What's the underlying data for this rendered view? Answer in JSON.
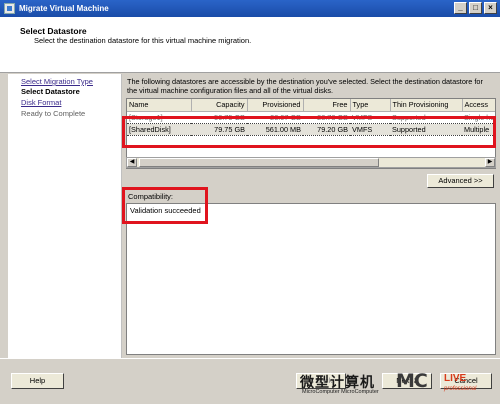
{
  "window": {
    "title": "Migrate Virtual Machine",
    "min": "_",
    "max": "□",
    "close": "×"
  },
  "header": {
    "title": "Select Datastore",
    "subtitle": "Select the destination datastore for this virtual machine migration."
  },
  "steps": [
    {
      "label": "Select Migration Type",
      "state": "link"
    },
    {
      "label": "Select Datastore",
      "state": "current"
    },
    {
      "label": "Disk Format",
      "state": "link"
    },
    {
      "label": "Ready to Complete",
      "state": "pending"
    }
  ],
  "description": "The following datastores are accessible by the destination you've selected. Select the destination datastore for the virtual machine configuration files and all of the virtual disks.",
  "table": {
    "columns": [
      "Name",
      "Capacity",
      "Provisioned",
      "Free",
      "Type",
      "Thin Provisioning",
      "Access"
    ],
    "rows": [
      [
        "[Storage1]",
        "50.75 GB",
        "28.07 GB",
        "28.78 GB",
        "VMFS",
        "Supported",
        "Single host"
      ],
      [
        "[SharedDisk]",
        "79.75 GB",
        "561.00 MB",
        "79.20 GB",
        "VMFS",
        "Supported",
        "Multiple"
      ]
    ]
  },
  "buttons": {
    "advanced": "Advanced >>",
    "help": "Help",
    "back": "≤ Back",
    "next": "Next ≥",
    "cancel": "Cancel"
  },
  "compatibility": {
    "label": "Compatibility:",
    "message": "Validation succeeded"
  },
  "watermark": {
    "cn": "微型计算机",
    "en": "MicroComputer  MicroComputer",
    "logo": "MC",
    "logo2": "LIVE",
    "pro": "professional"
  },
  "colors": {
    "highlight": "#e0141e",
    "titlebar": "#2a64c8"
  }
}
